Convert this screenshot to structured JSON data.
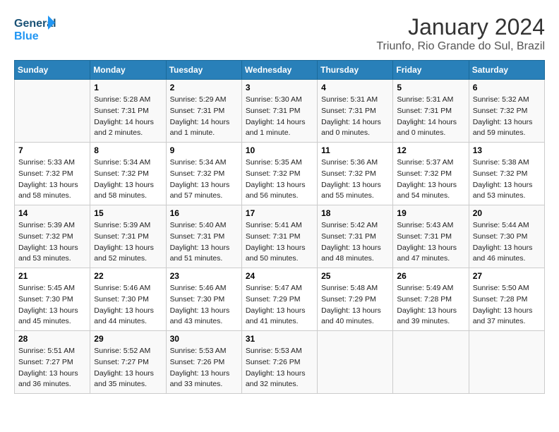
{
  "header": {
    "logo_line1": "General",
    "logo_line2": "Blue",
    "title": "January 2024",
    "subtitle": "Triunfo, Rio Grande do Sul, Brazil"
  },
  "days_of_week": [
    "Sunday",
    "Monday",
    "Tuesday",
    "Wednesday",
    "Thursday",
    "Friday",
    "Saturday"
  ],
  "weeks": [
    [
      {
        "day": "",
        "info": ""
      },
      {
        "day": "1",
        "info": "Sunrise: 5:28 AM\nSunset: 7:31 PM\nDaylight: 14 hours\nand 2 minutes."
      },
      {
        "day": "2",
        "info": "Sunrise: 5:29 AM\nSunset: 7:31 PM\nDaylight: 14 hours\nand 1 minute."
      },
      {
        "day": "3",
        "info": "Sunrise: 5:30 AM\nSunset: 7:31 PM\nDaylight: 14 hours\nand 1 minute."
      },
      {
        "day": "4",
        "info": "Sunrise: 5:31 AM\nSunset: 7:31 PM\nDaylight: 14 hours\nand 0 minutes."
      },
      {
        "day": "5",
        "info": "Sunrise: 5:31 AM\nSunset: 7:31 PM\nDaylight: 14 hours\nand 0 minutes."
      },
      {
        "day": "6",
        "info": "Sunrise: 5:32 AM\nSunset: 7:32 PM\nDaylight: 13 hours\nand 59 minutes."
      }
    ],
    [
      {
        "day": "7",
        "info": "Sunrise: 5:33 AM\nSunset: 7:32 PM\nDaylight: 13 hours\nand 58 minutes."
      },
      {
        "day": "8",
        "info": "Sunrise: 5:34 AM\nSunset: 7:32 PM\nDaylight: 13 hours\nand 58 minutes."
      },
      {
        "day": "9",
        "info": "Sunrise: 5:34 AM\nSunset: 7:32 PM\nDaylight: 13 hours\nand 57 minutes."
      },
      {
        "day": "10",
        "info": "Sunrise: 5:35 AM\nSunset: 7:32 PM\nDaylight: 13 hours\nand 56 minutes."
      },
      {
        "day": "11",
        "info": "Sunrise: 5:36 AM\nSunset: 7:32 PM\nDaylight: 13 hours\nand 55 minutes."
      },
      {
        "day": "12",
        "info": "Sunrise: 5:37 AM\nSunset: 7:32 PM\nDaylight: 13 hours\nand 54 minutes."
      },
      {
        "day": "13",
        "info": "Sunrise: 5:38 AM\nSunset: 7:32 PM\nDaylight: 13 hours\nand 53 minutes."
      }
    ],
    [
      {
        "day": "14",
        "info": "Sunrise: 5:39 AM\nSunset: 7:32 PM\nDaylight: 13 hours\nand 53 minutes."
      },
      {
        "day": "15",
        "info": "Sunrise: 5:39 AM\nSunset: 7:31 PM\nDaylight: 13 hours\nand 52 minutes."
      },
      {
        "day": "16",
        "info": "Sunrise: 5:40 AM\nSunset: 7:31 PM\nDaylight: 13 hours\nand 51 minutes."
      },
      {
        "day": "17",
        "info": "Sunrise: 5:41 AM\nSunset: 7:31 PM\nDaylight: 13 hours\nand 50 minutes."
      },
      {
        "day": "18",
        "info": "Sunrise: 5:42 AM\nSunset: 7:31 PM\nDaylight: 13 hours\nand 48 minutes."
      },
      {
        "day": "19",
        "info": "Sunrise: 5:43 AM\nSunset: 7:31 PM\nDaylight: 13 hours\nand 47 minutes."
      },
      {
        "day": "20",
        "info": "Sunrise: 5:44 AM\nSunset: 7:30 PM\nDaylight: 13 hours\nand 46 minutes."
      }
    ],
    [
      {
        "day": "21",
        "info": "Sunrise: 5:45 AM\nSunset: 7:30 PM\nDaylight: 13 hours\nand 45 minutes."
      },
      {
        "day": "22",
        "info": "Sunrise: 5:46 AM\nSunset: 7:30 PM\nDaylight: 13 hours\nand 44 minutes."
      },
      {
        "day": "23",
        "info": "Sunrise: 5:46 AM\nSunset: 7:30 PM\nDaylight: 13 hours\nand 43 minutes."
      },
      {
        "day": "24",
        "info": "Sunrise: 5:47 AM\nSunset: 7:29 PM\nDaylight: 13 hours\nand 41 minutes."
      },
      {
        "day": "25",
        "info": "Sunrise: 5:48 AM\nSunset: 7:29 PM\nDaylight: 13 hours\nand 40 minutes."
      },
      {
        "day": "26",
        "info": "Sunrise: 5:49 AM\nSunset: 7:28 PM\nDaylight: 13 hours\nand 39 minutes."
      },
      {
        "day": "27",
        "info": "Sunrise: 5:50 AM\nSunset: 7:28 PM\nDaylight: 13 hours\nand 37 minutes."
      }
    ],
    [
      {
        "day": "28",
        "info": "Sunrise: 5:51 AM\nSunset: 7:27 PM\nDaylight: 13 hours\nand 36 minutes."
      },
      {
        "day": "29",
        "info": "Sunrise: 5:52 AM\nSunset: 7:27 PM\nDaylight: 13 hours\nand 35 minutes."
      },
      {
        "day": "30",
        "info": "Sunrise: 5:53 AM\nSunset: 7:26 PM\nDaylight: 13 hours\nand 33 minutes."
      },
      {
        "day": "31",
        "info": "Sunrise: 5:53 AM\nSunset: 7:26 PM\nDaylight: 13 hours\nand 32 minutes."
      },
      {
        "day": "",
        "info": ""
      },
      {
        "day": "",
        "info": ""
      },
      {
        "day": "",
        "info": ""
      }
    ]
  ]
}
